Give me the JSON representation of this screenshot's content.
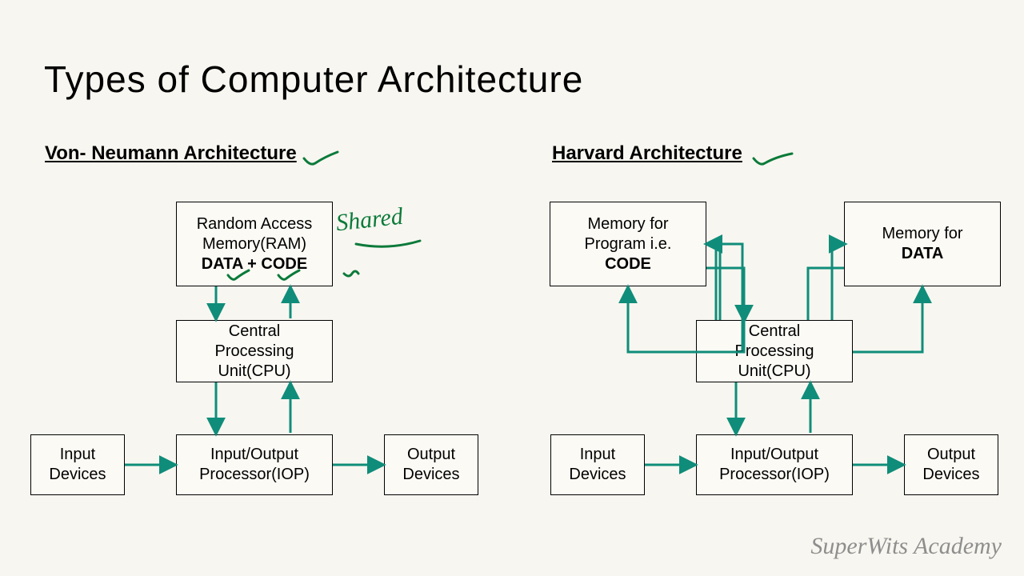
{
  "title": "Types of Computer Architecture",
  "watermark": "SuperWits Academy",
  "left": {
    "heading": "Von- Neumann Architecture",
    "ram_top": "Random Access",
    "ram_mid": "Memory(RAM)",
    "ram_bold": "DATA + CODE",
    "cpu_l1": "Central",
    "cpu_l2": "Processing",
    "cpu_l3": "Unit(CPU)",
    "input_l1": "Input",
    "input_l2": "Devices",
    "iop_l1": "Input/Output",
    "iop_l2": "Processor(IOP)",
    "output_l1": "Output",
    "output_l2": "Devices",
    "annotation": "Shared"
  },
  "right": {
    "heading": "Harvard Architecture",
    "code_l1": "Memory for",
    "code_l2": "Program i.e.",
    "code_bold": "CODE",
    "data_l1": "Memory for",
    "data_bold": "DATA",
    "cpu_l1": "Central",
    "cpu_l2": "Processing",
    "cpu_l3": "Unit(CPU)",
    "input_l1": "Input",
    "input_l2": "Devices",
    "iop_l1": "Input/Output",
    "iop_l2": "Processor(IOP)",
    "output_l1": "Output",
    "output_l2": "Devices"
  },
  "colors": {
    "arrow": "#0f8d7a",
    "annotation": "#0b7a3a"
  }
}
